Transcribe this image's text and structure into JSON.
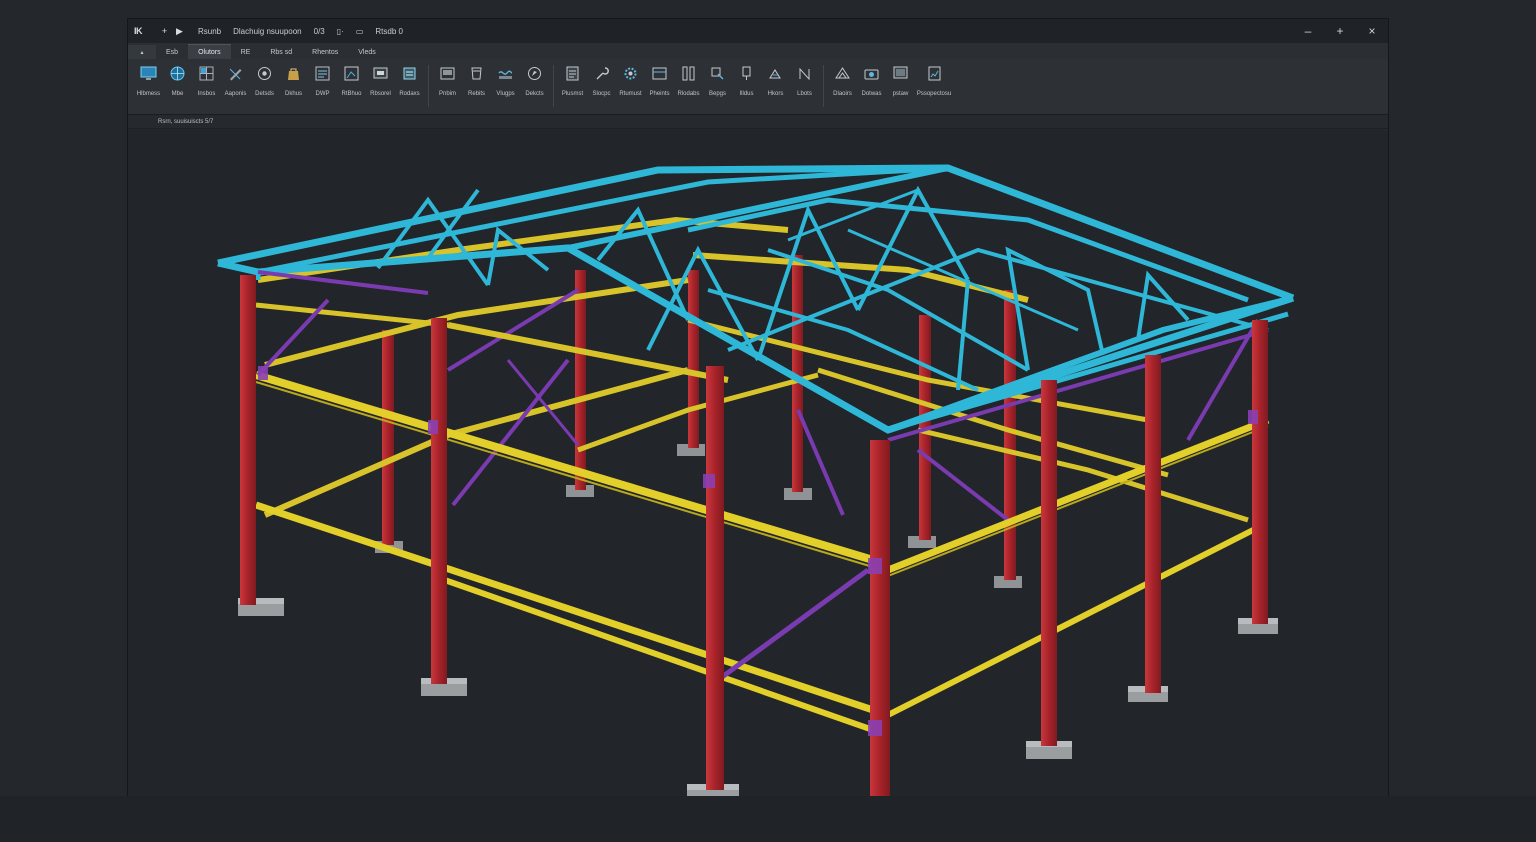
{
  "app": {
    "logo": "IK",
    "title_items": [
      "Rsunb",
      "Dlachuig nsuupoon",
      "0/3",
      "Rtsdb 0"
    ],
    "window_controls": {
      "minimize": "–",
      "maximize": "+",
      "close": "×"
    }
  },
  "quick_access": [
    "+",
    "▶"
  ],
  "tabs": [
    "",
    "Esb",
    "Olutors",
    "RE",
    "Rbs sd",
    "Rhentos",
    "Vleds"
  ],
  "ribbon": {
    "group1": [
      {
        "label": "Hlbmess",
        "icon": "monitor-icon"
      },
      {
        "label": "Mbe",
        "icon": "globe-icon"
      },
      {
        "label": "Insbos",
        "icon": "grid-icon"
      },
      {
        "label": "Aaponis",
        "icon": "pencil-icon"
      },
      {
        "label": "Detsds",
        "icon": "target-icon"
      },
      {
        "label": "Dkhus",
        "icon": "bag-icon"
      },
      {
        "label": "DWP",
        "icon": "sheet-icon"
      },
      {
        "label": "RtBhuo",
        "icon": "frame-icon"
      },
      {
        "label": "Rbsorel",
        "icon": "board-icon"
      },
      {
        "label": "Rodaxs",
        "icon": "stack-icon"
      }
    ],
    "group2": [
      {
        "label": "Pnbim",
        "icon": "window-icon"
      },
      {
        "label": "Rebits",
        "icon": "cup-icon"
      },
      {
        "label": "Vlugps",
        "icon": "wave-icon"
      },
      {
        "label": "Dekcts",
        "icon": "compass-icon"
      }
    ],
    "group3": [
      {
        "label": "Plusmst",
        "icon": "doc-icon"
      },
      {
        "label": "Slocpc",
        "icon": "wrench-icon"
      },
      {
        "label": "Rtumust",
        "icon": "gear-icon"
      },
      {
        "label": "Pheints",
        "icon": "panel-icon"
      },
      {
        "label": "Rlodabs",
        "icon": "columns-icon"
      },
      {
        "label": "Bepgs",
        "icon": "connect-icon"
      },
      {
        "label": "Illdus",
        "icon": "bolt-icon"
      },
      {
        "label": "Hkors",
        "icon": "weld-icon"
      },
      {
        "label": "Lbots",
        "icon": "brace-icon"
      }
    ],
    "group4": [
      {
        "label": "Dlaoirs",
        "icon": "truss-icon"
      },
      {
        "label": "Dotwas",
        "icon": "camera-icon"
      },
      {
        "label": "pstaw",
        "icon": "screen-icon"
      },
      {
        "label": "Pssopectosu",
        "icon": "report-icon"
      }
    ]
  },
  "status": {
    "text": "Rsrn, suuisuiscts 5/7"
  },
  "model": {
    "colors": {
      "columns": "#b3262b",
      "beams": "#e2cf2a",
      "bracing": "#7b3bb0",
      "roof_truss": "#2fb7d8",
      "footings": "#a3a6a8",
      "background": "#222529"
    }
  }
}
